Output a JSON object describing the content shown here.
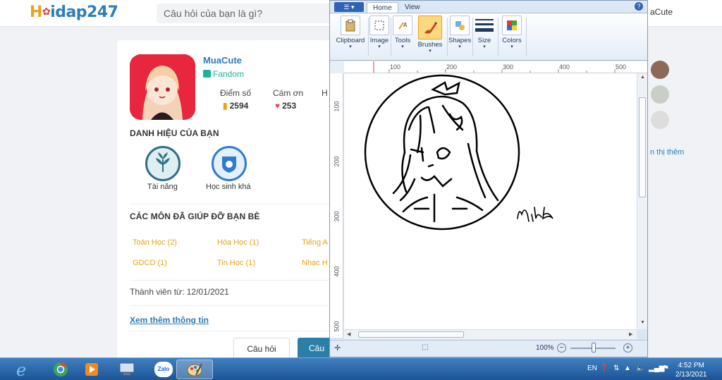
{
  "site": {
    "logo": {
      "h": "H",
      "rest": "idap247"
    },
    "search_placeholder": "Câu hỏi của bạn là gì?",
    "header_user": "aCute"
  },
  "profile": {
    "username": "MuaCute",
    "rank": "Fandom",
    "stats": [
      {
        "label": "Điểm số",
        "value": "2594",
        "icon": "points-icon"
      },
      {
        "label": "Cám ơn",
        "value": "253",
        "icon": "heart-icon"
      },
      {
        "label": "H",
        "value": ""
      }
    ],
    "badges_title": "DANH HIỆU CỦA BẠN",
    "badges": [
      {
        "label": "Tài năng",
        "icon": "leaf-badge-icon",
        "color": "#2f6f87"
      },
      {
        "label": "Học sinh khá",
        "icon": "shield-badge-icon",
        "color": "#2f7bd0"
      }
    ],
    "subjects_title": "CÁC MÔN ĐÃ GIÚP ĐỠ BẠN BÈ",
    "subjects": [
      "Toán Học (2)",
      "Hóa Học (1)",
      "Tiếng A",
      "GDCD (1)",
      "Tin Học (1)",
      "Nhạc H"
    ],
    "member_since": "Thành viên từ: 12/01/2021",
    "more_info": "Xem thêm thông tin",
    "tabs": [
      "Câu hỏi",
      "Câu"
    ]
  },
  "sidebar": {
    "show_more": "n thị thêm"
  },
  "paint": {
    "app_button": "▾",
    "tabs": [
      "Home",
      "View"
    ],
    "help": "?",
    "groups": [
      {
        "label": "Clipboard",
        "icon": "clipboard-icon"
      },
      {
        "label": "Image",
        "icon": "image-icon"
      },
      {
        "label": "Tools",
        "icon": "tools-icon"
      },
      {
        "label": "Brushes",
        "icon": "brush-icon",
        "selected": true
      },
      {
        "label": "Shapes",
        "icon": "shapes-icon"
      },
      {
        "label": "Size",
        "icon": "size-icon"
      },
      {
        "label": "Colors",
        "icon": "colors-icon"
      }
    ],
    "ruler_top": [
      "100",
      "200",
      "300",
      "400",
      "500"
    ],
    "ruler_left": [
      "100",
      "200",
      "300",
      "400",
      "500"
    ],
    "signature": "Mila",
    "zoom": "100%",
    "zoom_minus": "−",
    "zoom_plus": "+"
  },
  "taskbar": {
    "apps": [
      {
        "name": "ie-icon"
      },
      {
        "name": "chrome-icon"
      },
      {
        "name": "media-player-icon"
      },
      {
        "name": "computer-icon"
      },
      {
        "name": "zalo-icon",
        "text": "Zalo"
      },
      {
        "name": "paint-icon",
        "active": true
      }
    ],
    "lang": "EN",
    "time": "4:52 PM",
    "date": "2/13/2021"
  }
}
